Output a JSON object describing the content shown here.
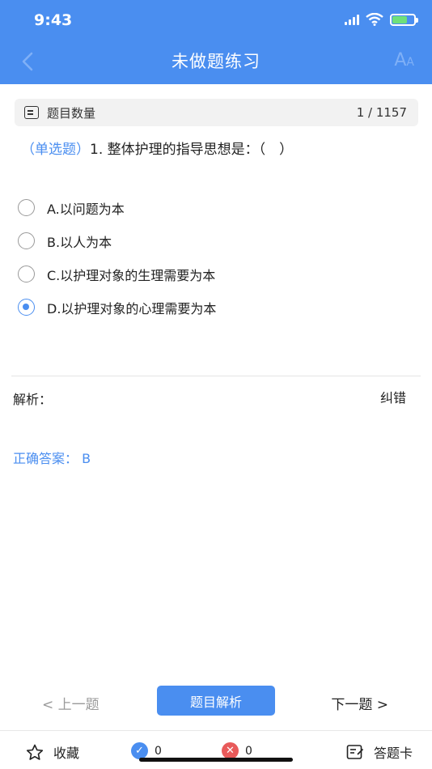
{
  "status": {
    "time": "9:43"
  },
  "nav": {
    "title": "未做题练习",
    "font_a_big": "A",
    "font_a_small": "A"
  },
  "count_bar": {
    "label": "题目数量",
    "value": "1 / 1157"
  },
  "question": {
    "type": "（单选题）",
    "text": "1. 整体护理的指导思想是：（　）"
  },
  "options": [
    {
      "label": "A.以问题为本",
      "checked": false
    },
    {
      "label": "B.以人为本",
      "checked": false
    },
    {
      "label": "C.以护理对象的生理需要为本",
      "checked": false
    },
    {
      "label": "D.以护理对象的心理需要为本",
      "checked": true
    }
  ],
  "analysis": {
    "label": "解析：",
    "correct_label": "纠错",
    "answer": "正确答案： B"
  },
  "bottom_nav": {
    "prev": "< 上一题",
    "analysis": "题目解析",
    "next": "下一题 >"
  },
  "tabbar": {
    "favorite": "收藏",
    "right_count": "0",
    "wrong_count": "0",
    "answer_card": "答题卡"
  },
  "colors": {
    "accent": "#4a8ef0",
    "wrong": "#e85a5a"
  }
}
